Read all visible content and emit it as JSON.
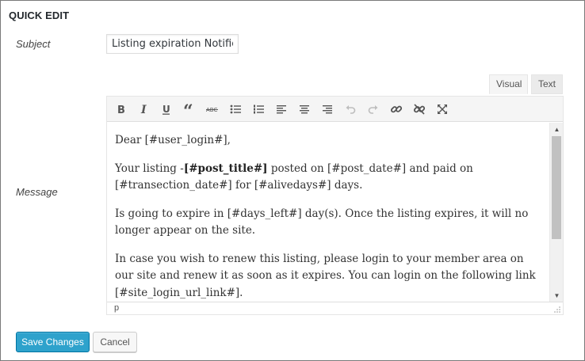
{
  "header": {
    "title": "QUICK EDIT"
  },
  "subject": {
    "label": "Subject",
    "value": "Listing expiration Notificat"
  },
  "message": {
    "label": "Message"
  },
  "editor": {
    "tabs": [
      {
        "label": "Visual",
        "active": true
      },
      {
        "label": "Text",
        "active": false
      }
    ],
    "toolbar": [
      {
        "name": "bold",
        "icon": "bold-icon"
      },
      {
        "name": "italic",
        "icon": "italic-icon"
      },
      {
        "name": "underline",
        "icon": "underline-icon"
      },
      {
        "name": "blockquote",
        "icon": "blockquote-icon"
      },
      {
        "name": "strikethrough",
        "icon": "strikethrough-icon"
      },
      {
        "name": "bulleted-list",
        "icon": "bullet-list-icon"
      },
      {
        "name": "numbered-list",
        "icon": "numbered-list-icon"
      },
      {
        "name": "align-left",
        "icon": "align-left-icon"
      },
      {
        "name": "align-center",
        "icon": "align-center-icon"
      },
      {
        "name": "align-right",
        "icon": "align-right-icon"
      },
      {
        "name": "undo",
        "icon": "undo-icon"
      },
      {
        "name": "redo",
        "icon": "redo-icon"
      },
      {
        "name": "insert-link",
        "icon": "link-icon"
      },
      {
        "name": "remove-link",
        "icon": "unlink-icon"
      },
      {
        "name": "fullscreen",
        "icon": "fullscreen-icon"
      }
    ],
    "strikethrough_glyph": "ABC",
    "content": {
      "p1": "Dear [#user_login#],",
      "p2_prefix": "Your listing -",
      "p2_bold": "[#post_title#]",
      "p2_suffix": " posted on [#post_date#] and paid on [#transection_date#] for [#alivedays#] days.",
      "p3": "Is going to expire in [#days_left#] day(s). Once the listing expires, it will no longer appear on the site.",
      "p4": "In case you wish to renew this listing, please login to your member area on our site and renew it as soon as it expires. You can login on the following link [#site_login_url_link#]."
    },
    "status_path": "p"
  },
  "actions": {
    "save_label": "Save Changes",
    "cancel_label": "Cancel"
  },
  "colors": {
    "primary_button": "#2ea2cc",
    "primary_border": "#0074a2"
  }
}
